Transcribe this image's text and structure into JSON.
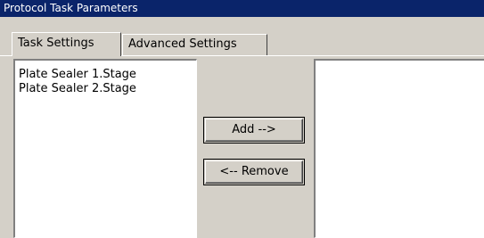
{
  "window": {
    "title": "Protocol Task Parameters"
  },
  "tabs": [
    {
      "label": "Task Settings",
      "active": true
    },
    {
      "label": "Advanced Settings",
      "active": false
    }
  ],
  "available_list": {
    "items": [
      "Plate Sealer 1.Stage",
      "Plate Sealer 2.Stage"
    ]
  },
  "selected_list": {
    "items": []
  },
  "buttons": {
    "add_label": "Add -->",
    "remove_label": "<-- Remove"
  },
  "colors": {
    "titlebar_bg": "#0a246a",
    "face": "#d4d0c8",
    "list_bg": "#ffffff"
  }
}
